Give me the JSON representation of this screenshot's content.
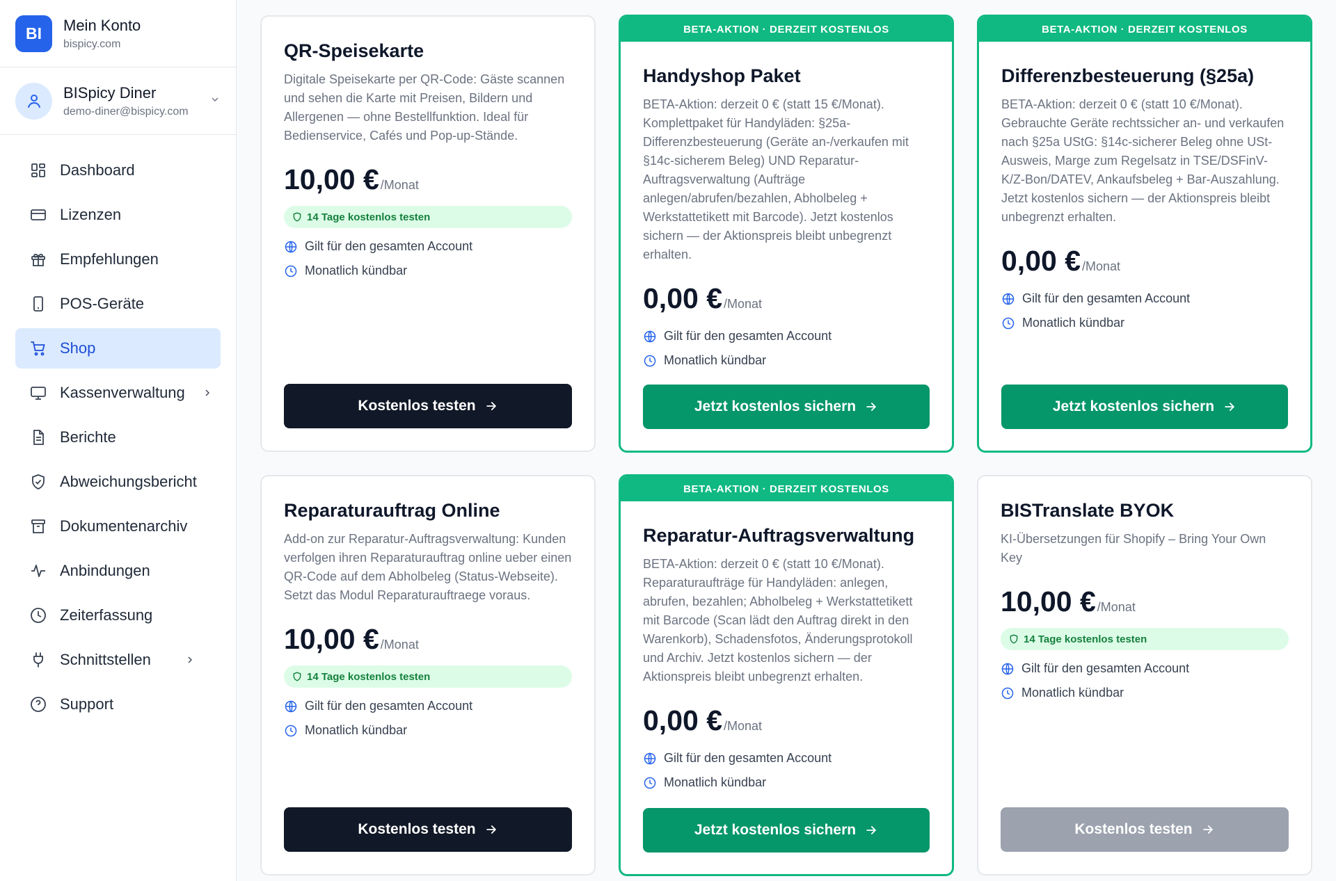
{
  "brand": {
    "logo": "BI",
    "title": "Mein Konto",
    "subtitle": "bispicy.com"
  },
  "account": {
    "name": "BISpicy Diner",
    "email": "demo-diner@bispicy.com"
  },
  "nav": [
    {
      "label": "Dashboard",
      "icon": "grid-icon"
    },
    {
      "label": "Lizenzen",
      "icon": "card-icon"
    },
    {
      "label": "Empfehlungen",
      "icon": "gift-icon"
    },
    {
      "label": "POS-Geräte",
      "icon": "device-icon"
    },
    {
      "label": "Shop",
      "icon": "cart-icon",
      "active": true
    },
    {
      "label": "Kassenverwaltung",
      "icon": "monitor-icon",
      "expandable": true
    },
    {
      "label": "Berichte",
      "icon": "document-icon"
    },
    {
      "label": "Abweichungsbericht",
      "icon": "shield-check-icon"
    },
    {
      "label": "Dokumentenarchiv",
      "icon": "archive-icon"
    },
    {
      "label": "Anbindungen",
      "icon": "pulse-icon"
    },
    {
      "label": "Zeiterfassung",
      "icon": "clock-icon"
    },
    {
      "label": "Schnittstellen",
      "icon": "plug-icon",
      "expandable": true
    },
    {
      "label": "Support",
      "icon": "help-icon"
    }
  ],
  "common": {
    "per_month": "/Monat",
    "trial_label": "14 Tage kostenlos testen",
    "feature_account": "Gilt für den gesamten Account",
    "feature_cancel": "Monatlich kündbar",
    "promo_banner": "BETA-AKTION · DERZEIT KOSTENLOS"
  },
  "products": [
    {
      "title": "QR-Speisekarte",
      "description": "Digitale Speisekarte per QR-Code: Gäste scannen und sehen die Karte mit Preisen, Bildern und Allergenen — ohne Bestellfunktion. Ideal für Bedienservice, Cafés und Pop-up-Stände.",
      "price": "10,00 €",
      "button": "Kostenlos testen"
    },
    {
      "title": "Handyshop Paket",
      "description": "BETA-Aktion: derzeit 0 € (statt 15 €/Monat). Komplettpaket für Handyläden: §25a-Differenzbesteuerung (Geräte an-/verkaufen mit §14c-sicherem Beleg) UND Reparatur-Auftragsverwaltung (Aufträge anlegen/abrufen/bezahlen, Abholbeleg + Werkstattetikett mit Barcode). Jetzt kostenlos sichern — der Aktionspreis bleibt unbegrenzt erhalten.",
      "price": "0,00 €",
      "button": "Jetzt kostenlos sichern"
    },
    {
      "title": "Differenzbesteuerung (§25a)",
      "description": "BETA-Aktion: derzeit 0 € (statt 10 €/Monat). Gebrauchte Geräte rechtssicher an- und verkaufen nach §25a UStG: §14c-sicherer Beleg ohne USt-Ausweis, Marge zum Regelsatz in TSE/DSFinV-K/Z-Bon/DATEV, Ankaufsbeleg + Bar-Auszahlung. Jetzt kostenlos sichern — der Aktionspreis bleibt unbegrenzt erhalten.",
      "price": "0,00 €",
      "button": "Jetzt kostenlos sichern"
    },
    {
      "title": "Reparaturauftrag Online",
      "description": "Add-on zur Reparatur-Auftragsverwaltung: Kunden verfolgen ihren Reparaturauftrag online ueber einen QR-Code auf dem Abholbeleg (Status-Webseite). Setzt das Modul Reparaturauftraege voraus.",
      "price": "10,00 €",
      "button": "Kostenlos testen"
    },
    {
      "title": "Reparatur-Auftragsverwaltung",
      "description": "BETA-Aktion: derzeit 0 € (statt 10 €/Monat). Reparaturaufträge für Handyläden: anlegen, abrufen, bezahlen; Abholbeleg + Werkstattetikett mit Barcode (Scan lädt den Auftrag direkt in den Warenkorb), Schadensfotos, Änderungsprotokoll und Archiv. Jetzt kostenlos sichern — der Aktionspreis bleibt unbegrenzt erhalten.",
      "price": "0,00 €",
      "button": "Jetzt kostenlos sichern"
    },
    {
      "title": "BISTranslate BYOK",
      "description": "KI-Übersetzungen für Shopify – Bring Your Own Key",
      "price": "10,00 €",
      "button": "Kostenlos testen"
    }
  ],
  "colors": {
    "accent": "#2563eb",
    "promo": "#10b981",
    "promo_button": "#059669",
    "dark_button": "#111827",
    "disabled_button": "#9ca3af"
  }
}
